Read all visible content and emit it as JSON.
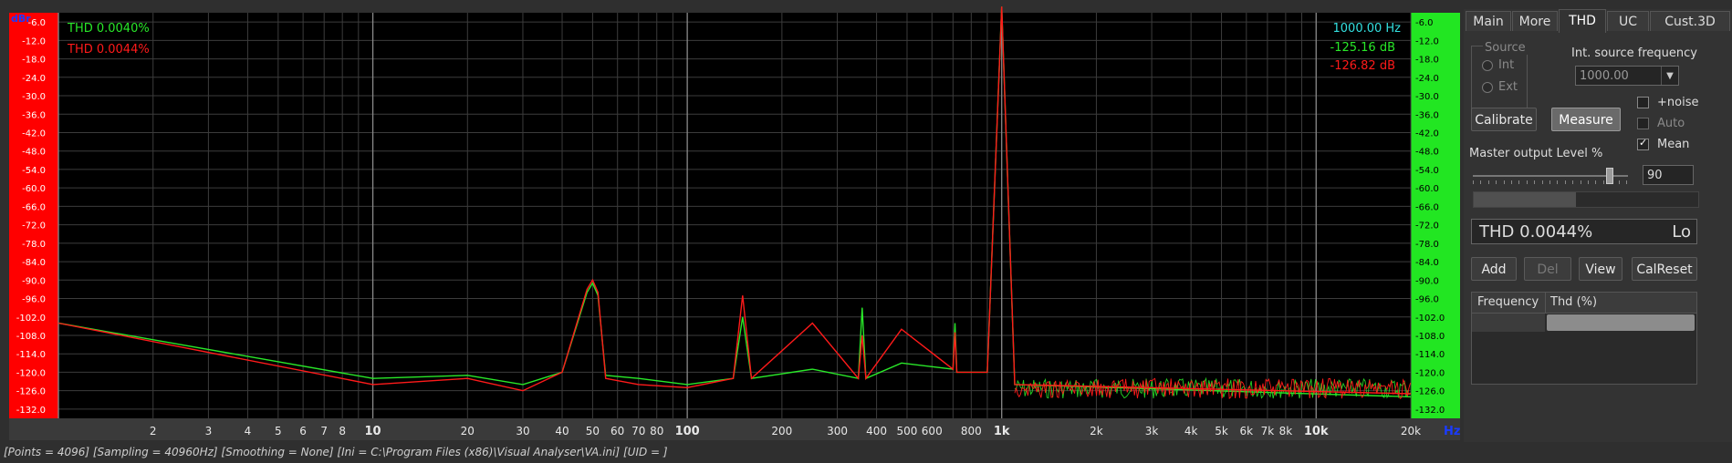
{
  "plot": {
    "left_axis_unit": "dBr",
    "right_axis_unit": "Hz",
    "y_ticks": [
      "-6.0",
      "-12.0",
      "-18.0",
      "-24.0",
      "-30.0",
      "-36.0",
      "-42.0",
      "-48.0",
      "-54.0",
      "-60.0",
      "-66.0",
      "-72.0",
      "-78.0",
      "-84.0",
      "-90.0",
      "-96.0",
      "-102.0",
      "-108.0",
      "-114.0",
      "-120.0",
      "-126.0",
      "-132.0"
    ],
    "x_ticks": [
      {
        "v": 2,
        "t": "2"
      },
      {
        "v": 3,
        "t": "3"
      },
      {
        "v": 4,
        "t": "4"
      },
      {
        "v": 5,
        "t": "5"
      },
      {
        "v": 6,
        "t": "6"
      },
      {
        "v": 7,
        "t": "7"
      },
      {
        "v": 8,
        "t": "8"
      },
      {
        "v": 10,
        "t": "10",
        "major": true
      },
      {
        "v": 20,
        "t": "20"
      },
      {
        "v": 30,
        "t": "30"
      },
      {
        "v": 40,
        "t": "40"
      },
      {
        "v": 50,
        "t": "50"
      },
      {
        "v": 60,
        "t": "60"
      },
      {
        "v": 70,
        "t": "70"
      },
      {
        "v": 80,
        "t": "80"
      },
      {
        "v": 100,
        "t": "100",
        "major": true
      },
      {
        "v": 200,
        "t": "200"
      },
      {
        "v": 300,
        "t": "300"
      },
      {
        "v": 400,
        "t": "400"
      },
      {
        "v": 500,
        "t": "500"
      },
      {
        "v": 600,
        "t": "600"
      },
      {
        "v": 800,
        "t": "800"
      },
      {
        "v": 1000,
        "t": "1k",
        "major": true
      },
      {
        "v": 2000,
        "t": "2k"
      },
      {
        "v": 3000,
        "t": "3k"
      },
      {
        "v": 4000,
        "t": "4k"
      },
      {
        "v": 5000,
        "t": "5k"
      },
      {
        "v": 6000,
        "t": "6k"
      },
      {
        "v": 7000,
        "t": "7k"
      },
      {
        "v": 8000,
        "t": "8k"
      },
      {
        "v": 10000,
        "t": "10k",
        "major": true
      },
      {
        "v": 20000,
        "t": "20k"
      }
    ],
    "thd_green": "THD 0.0040%",
    "thd_red": "THD 0.0044%",
    "readout_freq": "1000.00 Hz",
    "readout_green": "-125.16 dB",
    "readout_red": "-126.82 dB",
    "colors": {
      "green": "#29e829",
      "red": "#ff1a1a",
      "left_axis_bg": "#ff0000",
      "right_axis_bg": "#22e622",
      "cyan": "#33e0e0",
      "bg": "#000000"
    }
  },
  "chart_data": {
    "type": "line",
    "xlabel": "Hz",
    "ylabel": "dBr",
    "xscale": "log",
    "xlim": [
      1,
      20000
    ],
    "ylim": [
      -135,
      -3
    ],
    "series": [
      {
        "color": "green",
        "x": [
          1,
          10,
          20,
          30,
          40,
          48,
          50,
          52,
          55,
          70,
          100,
          140,
          150,
          160,
          250,
          350,
          360,
          370,
          480,
          700,
          710,
          720,
          900,
          1000,
          1100,
          20000
        ],
        "y": [
          -104,
          -122,
          -121,
          -124,
          -120,
          -94,
          -91,
          -95,
          -121,
          -122,
          -124,
          -122,
          -102,
          -122,
          -119,
          -122,
          -99,
          -122,
          -117,
          -119,
          -104,
          -120,
          -120,
          -1,
          -124,
          -128
        ]
      },
      {
        "color": "red",
        "x": [
          1,
          10,
          20,
          30,
          40,
          48,
          50,
          52,
          55,
          70,
          100,
          140,
          150,
          160,
          250,
          350,
          360,
          370,
          480,
          700,
          710,
          720,
          900,
          1000,
          1100,
          20000
        ],
        "y": [
          -104,
          -124,
          -122,
          -126,
          -120,
          -93,
          -90,
          -94,
          -122,
          -124,
          -125,
          -122,
          -95,
          -122,
          -104,
          -122,
          -108,
          -122,
          -106,
          -119,
          -107,
          -120,
          -120,
          -1,
          -124,
          -127
        ]
      }
    ]
  },
  "tabs": [
    {
      "label": "Main"
    },
    {
      "label": "More"
    },
    {
      "label": "THD",
      "active": true
    },
    {
      "label": "UC"
    },
    {
      "label": "Cust.3D"
    }
  ],
  "thd_panel": {
    "source_group": "Source",
    "source_int": "Int",
    "source_ext": "Ext",
    "int_freq_label": "Int. source frequency",
    "int_freq_value": "1000.00",
    "noise_label": "+noise",
    "auto_label": "Auto",
    "mean_label": "Mean",
    "calibrate": "Calibrate",
    "measure": "Measure",
    "master_level_label": "Master output Level %",
    "master_level_value": "90",
    "master_level_fraction": 0.9,
    "thd_display": "THD 0.0044%",
    "thd_range": "Lo",
    "add": "Add",
    "del": "Del",
    "view": "View",
    "calreset": "CalReset",
    "table_headers": [
      "Frequency",
      "Thd (%)"
    ]
  },
  "status_bar": "[Points = 4096]  [Sampling = 40960Hz]  [Smoothing = None]  [Ini = C:\\Program Files (x86)\\Visual Analyser\\VA.ini]  [UID = ]"
}
